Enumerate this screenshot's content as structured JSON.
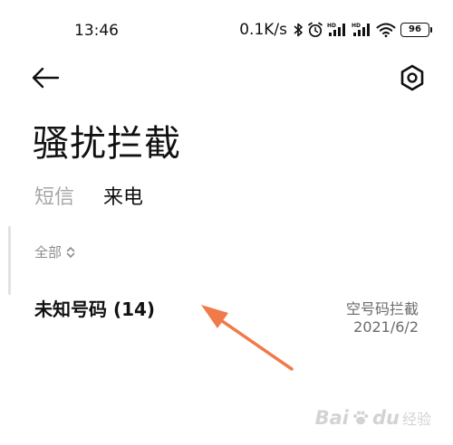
{
  "status_bar": {
    "time": "13:46",
    "net_speed": "0.1K/s",
    "battery": "96",
    "icons": [
      "bluetooth-icon",
      "alarm-icon",
      "signal-hd-icon",
      "signal-hd-icon",
      "wifi-icon",
      "battery-icon"
    ]
  },
  "header": {
    "back_icon": "arrow-left-icon",
    "settings_icon": "settings-icon",
    "title": "骚扰拦截"
  },
  "tabs": [
    {
      "label": "短信",
      "active": false
    },
    {
      "label": "来电",
      "active": true
    }
  ],
  "filter": {
    "label": "全部",
    "icon": "chevron-updown-icon"
  },
  "list": [
    {
      "title": "未知号码 (14)",
      "type": "空号码拦截",
      "date": "2021/6/2"
    }
  ],
  "annotation": {
    "color": "#f07a4a"
  },
  "watermark": {
    "brand": "Bai",
    "brand2": "du",
    "suffix": "经验"
  }
}
